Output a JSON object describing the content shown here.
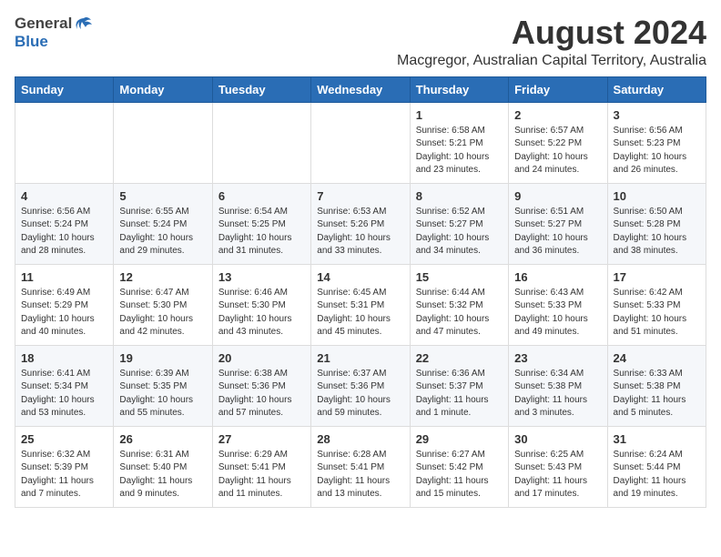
{
  "header": {
    "logo_general": "General",
    "logo_blue": "Blue",
    "title": "August 2024",
    "subtitle": "Macgregor, Australian Capital Territory, Australia"
  },
  "calendar": {
    "days_of_week": [
      "Sunday",
      "Monday",
      "Tuesday",
      "Wednesday",
      "Thursday",
      "Friday",
      "Saturday"
    ],
    "weeks": [
      [
        {
          "day": "",
          "info": ""
        },
        {
          "day": "",
          "info": ""
        },
        {
          "day": "",
          "info": ""
        },
        {
          "day": "",
          "info": ""
        },
        {
          "day": "1",
          "info": "Sunrise: 6:58 AM\nSunset: 5:21 PM\nDaylight: 10 hours\nand 23 minutes."
        },
        {
          "day": "2",
          "info": "Sunrise: 6:57 AM\nSunset: 5:22 PM\nDaylight: 10 hours\nand 24 minutes."
        },
        {
          "day": "3",
          "info": "Sunrise: 6:56 AM\nSunset: 5:23 PM\nDaylight: 10 hours\nand 26 minutes."
        }
      ],
      [
        {
          "day": "4",
          "info": "Sunrise: 6:56 AM\nSunset: 5:24 PM\nDaylight: 10 hours\nand 28 minutes."
        },
        {
          "day": "5",
          "info": "Sunrise: 6:55 AM\nSunset: 5:24 PM\nDaylight: 10 hours\nand 29 minutes."
        },
        {
          "day": "6",
          "info": "Sunrise: 6:54 AM\nSunset: 5:25 PM\nDaylight: 10 hours\nand 31 minutes."
        },
        {
          "day": "7",
          "info": "Sunrise: 6:53 AM\nSunset: 5:26 PM\nDaylight: 10 hours\nand 33 minutes."
        },
        {
          "day": "8",
          "info": "Sunrise: 6:52 AM\nSunset: 5:27 PM\nDaylight: 10 hours\nand 34 minutes."
        },
        {
          "day": "9",
          "info": "Sunrise: 6:51 AM\nSunset: 5:27 PM\nDaylight: 10 hours\nand 36 minutes."
        },
        {
          "day": "10",
          "info": "Sunrise: 6:50 AM\nSunset: 5:28 PM\nDaylight: 10 hours\nand 38 minutes."
        }
      ],
      [
        {
          "day": "11",
          "info": "Sunrise: 6:49 AM\nSunset: 5:29 PM\nDaylight: 10 hours\nand 40 minutes."
        },
        {
          "day": "12",
          "info": "Sunrise: 6:47 AM\nSunset: 5:30 PM\nDaylight: 10 hours\nand 42 minutes."
        },
        {
          "day": "13",
          "info": "Sunrise: 6:46 AM\nSunset: 5:30 PM\nDaylight: 10 hours\nand 43 minutes."
        },
        {
          "day": "14",
          "info": "Sunrise: 6:45 AM\nSunset: 5:31 PM\nDaylight: 10 hours\nand 45 minutes."
        },
        {
          "day": "15",
          "info": "Sunrise: 6:44 AM\nSunset: 5:32 PM\nDaylight: 10 hours\nand 47 minutes."
        },
        {
          "day": "16",
          "info": "Sunrise: 6:43 AM\nSunset: 5:33 PM\nDaylight: 10 hours\nand 49 minutes."
        },
        {
          "day": "17",
          "info": "Sunrise: 6:42 AM\nSunset: 5:33 PM\nDaylight: 10 hours\nand 51 minutes."
        }
      ],
      [
        {
          "day": "18",
          "info": "Sunrise: 6:41 AM\nSunset: 5:34 PM\nDaylight: 10 hours\nand 53 minutes."
        },
        {
          "day": "19",
          "info": "Sunrise: 6:39 AM\nSunset: 5:35 PM\nDaylight: 10 hours\nand 55 minutes."
        },
        {
          "day": "20",
          "info": "Sunrise: 6:38 AM\nSunset: 5:36 PM\nDaylight: 10 hours\nand 57 minutes."
        },
        {
          "day": "21",
          "info": "Sunrise: 6:37 AM\nSunset: 5:36 PM\nDaylight: 10 hours\nand 59 minutes."
        },
        {
          "day": "22",
          "info": "Sunrise: 6:36 AM\nSunset: 5:37 PM\nDaylight: 11 hours\nand 1 minute."
        },
        {
          "day": "23",
          "info": "Sunrise: 6:34 AM\nSunset: 5:38 PM\nDaylight: 11 hours\nand 3 minutes."
        },
        {
          "day": "24",
          "info": "Sunrise: 6:33 AM\nSunset: 5:38 PM\nDaylight: 11 hours\nand 5 minutes."
        }
      ],
      [
        {
          "day": "25",
          "info": "Sunrise: 6:32 AM\nSunset: 5:39 PM\nDaylight: 11 hours\nand 7 minutes."
        },
        {
          "day": "26",
          "info": "Sunrise: 6:31 AM\nSunset: 5:40 PM\nDaylight: 11 hours\nand 9 minutes."
        },
        {
          "day": "27",
          "info": "Sunrise: 6:29 AM\nSunset: 5:41 PM\nDaylight: 11 hours\nand 11 minutes."
        },
        {
          "day": "28",
          "info": "Sunrise: 6:28 AM\nSunset: 5:41 PM\nDaylight: 11 hours\nand 13 minutes."
        },
        {
          "day": "29",
          "info": "Sunrise: 6:27 AM\nSunset: 5:42 PM\nDaylight: 11 hours\nand 15 minutes."
        },
        {
          "day": "30",
          "info": "Sunrise: 6:25 AM\nSunset: 5:43 PM\nDaylight: 11 hours\nand 17 minutes."
        },
        {
          "day": "31",
          "info": "Sunrise: 6:24 AM\nSunset: 5:44 PM\nDaylight: 11 hours\nand 19 minutes."
        }
      ]
    ]
  }
}
